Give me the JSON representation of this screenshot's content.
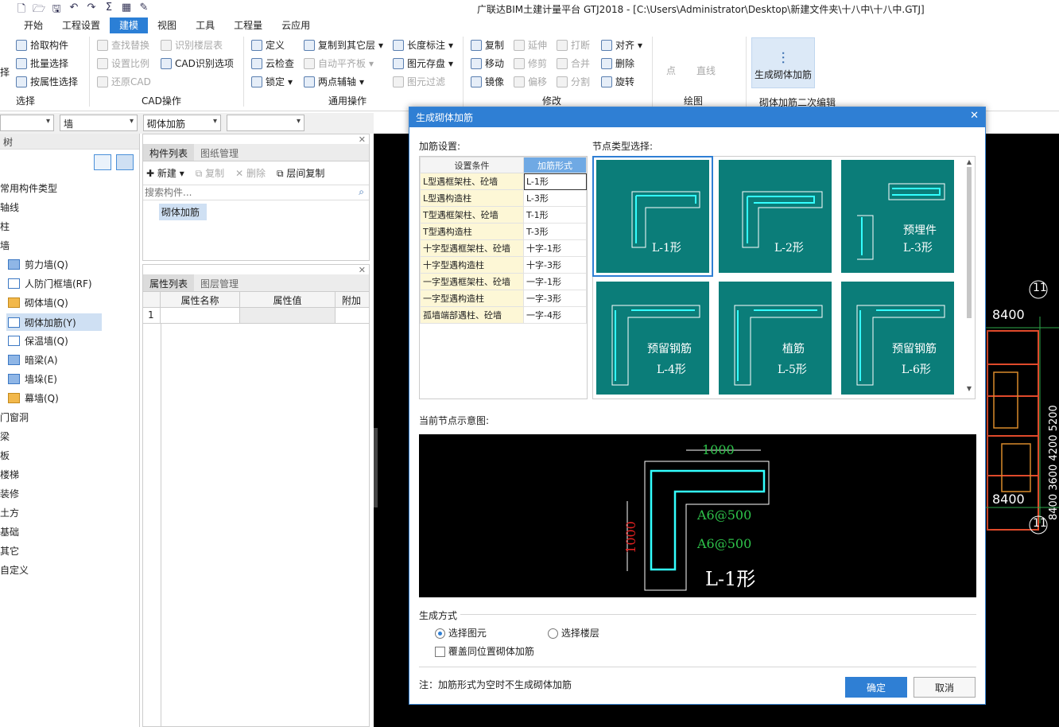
{
  "app": {
    "title": "广联达BIM土建计量平台 GTJ2018 - [C:\\Users\\Administrator\\Desktop\\新建文件夹\\十八中\\十八中.GTJ]"
  },
  "menu": [
    "开始",
    "工程设置",
    "建模",
    "视图",
    "工具",
    "工程量",
    "云应用"
  ],
  "ribbon": {
    "select": {
      "items": [
        "拾取构件",
        "批量选择",
        "按属性选择"
      ],
      "label": "选择",
      "left_fragment": "择"
    },
    "cad": {
      "items": [
        "查找替换",
        "识别楼层表",
        "设置比例",
        "CAD识别选项",
        "还原CAD"
      ],
      "label": "CAD操作"
    },
    "general": {
      "items": [
        "定义",
        "复制到其它层",
        "长度标注",
        "云检查",
        "自动平齐板",
        "图元存盘",
        "锁定",
        "两点辅轴",
        "图元过滤"
      ],
      "label": "通用操作"
    },
    "modify": {
      "items": [
        "复制",
        "延伸",
        "打断",
        "对齐",
        "移动",
        "修剪",
        "合并",
        "删除",
        "镜像",
        "偏移",
        "分割",
        "旋转"
      ],
      "label": "修改"
    },
    "draw": {
      "items": [
        "点",
        "直线"
      ],
      "label": "绘图"
    },
    "masonry": {
      "button": "生成砌体加筋",
      "label": "砌体加筋二次编辑"
    }
  },
  "toolbar2": {
    "combo1": "",
    "combo2": "墙",
    "combo3": "砌体加筋",
    "combo4": ""
  },
  "tree": {
    "header": "树",
    "items": [
      "常用构件类型",
      "轴线",
      "柱",
      "墙",
      "剪力墙(Q)",
      "人防门框墙(RF)",
      "砌体墙(Q)",
      "砌体加筋(Y)",
      "保温墙(Q)",
      "暗梁(A)",
      "墙垛(E)",
      "幕墙(Q)",
      "门窗洞",
      "梁",
      "板",
      "楼梯",
      "装修",
      "土方",
      "基础",
      "其它",
      "自定义"
    ]
  },
  "component_panel": {
    "tabs": [
      "构件列表",
      "图纸管理"
    ],
    "actions": [
      "新建",
      "复制",
      "删除",
      "层间复制"
    ],
    "search_placeholder": "搜索构件...",
    "items": [
      "砌体加筋"
    ]
  },
  "property_panel": {
    "tabs": [
      "属性列表",
      "图层管理"
    ],
    "columns": [
      "属性名称",
      "属性值",
      "附加"
    ],
    "rows": [
      "1"
    ]
  },
  "cad_labels": {
    "axis_top": "11",
    "axis_bottom": "11",
    "dim1": "8400",
    "dim2": "8400",
    "v1": "5200",
    "v2": "4200",
    "v3": "3600",
    "v4": "8400"
  },
  "dialog": {
    "title": "生成砌体加筋",
    "settings_label": "加筋设置:",
    "nodes_label": "节点类型选择:",
    "columns": [
      "设置条件",
      "加筋形式"
    ],
    "rows": [
      {
        "condition": "L型遇框架柱、砼墙",
        "form": "L-1形"
      },
      {
        "condition": "L型遇构造柱",
        "form": "L-3形"
      },
      {
        "condition": "T型遇框架柱、砼墙",
        "form": "T-1形"
      },
      {
        "condition": "T型遇构造柱",
        "form": "T-3形"
      },
      {
        "condition": "十字型遇框架柱、砼墙",
        "form": "十字-1形"
      },
      {
        "condition": "十字型遇构造柱",
        "form": "十字-3形"
      },
      {
        "condition": "一字型遇框架柱、砼墙",
        "form": "一字-1形"
      },
      {
        "condition": "一字型遇构造柱",
        "form": "一字-3形"
      },
      {
        "condition": "孤墙端部遇柱、砼墙",
        "form": "一字-4形"
      }
    ],
    "nodes": [
      {
        "name": "L-1形",
        "sub": ""
      },
      {
        "name": "L-2形",
        "sub": ""
      },
      {
        "name": "L-3形",
        "sub": "预埋件"
      },
      {
        "name": "L-4形",
        "sub": "预留钢筋"
      },
      {
        "name": "L-5形",
        "sub": "植筋"
      },
      {
        "name": "L-6形",
        "sub": "预留钢筋"
      }
    ],
    "preview_label": "当前节点示意图:",
    "preview": {
      "dim_top": "1000",
      "dim_left": "1000",
      "rebar1": "A6@500",
      "rebar2": "A6@500",
      "name": "L-1形"
    },
    "gen_label": "生成方式",
    "radio1": "选择图元",
    "radio2": "选择楼层",
    "checkbox": "覆盖同位置砌体加筋",
    "note": "注：加筋形式为空时不生成砌体加筋",
    "ok": "确定",
    "cancel": "取消"
  }
}
